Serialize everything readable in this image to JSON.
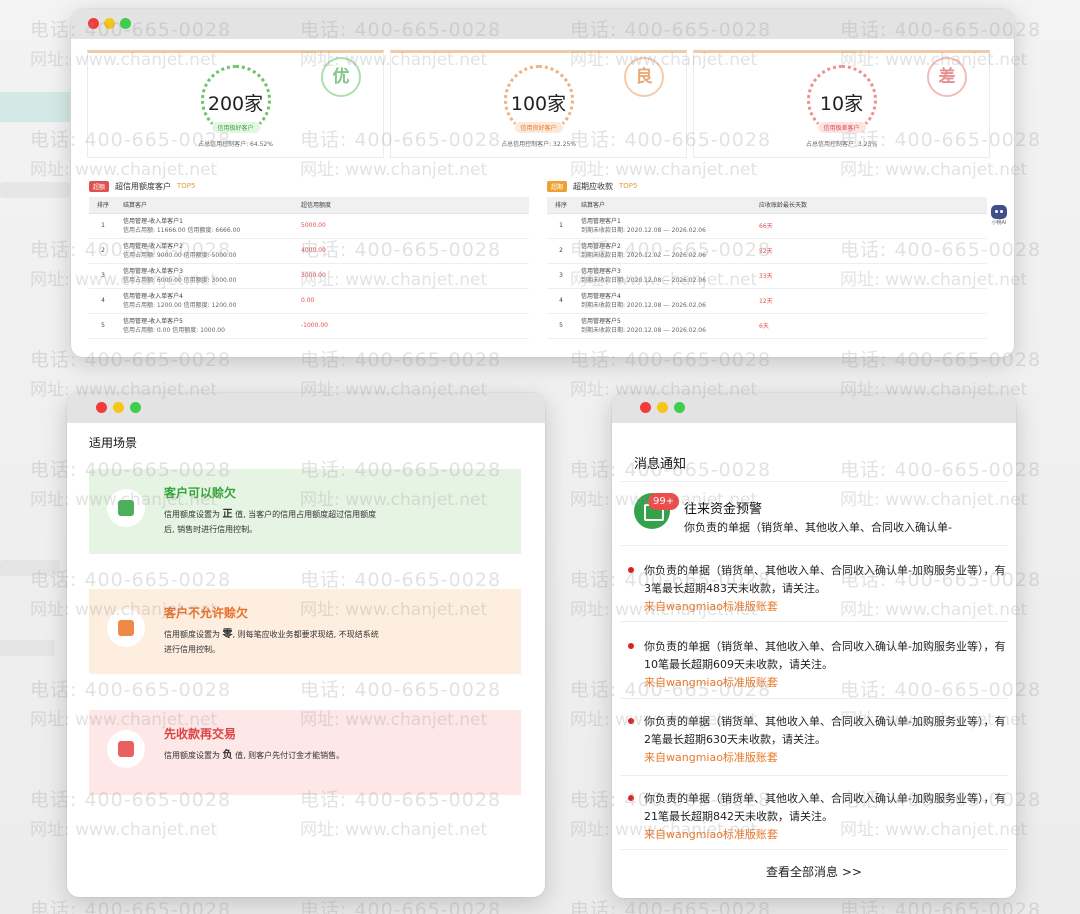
{
  "watermark": {
    "phone": "电话: 400-665-0028",
    "site": "网址: www.chanjet.net"
  },
  "credit_dashboard": {
    "scores": [
      {
        "count": "200家",
        "tag": "信用极好客户",
        "share": "占总信用控制客户: 64.52%",
        "stamp": "优"
      },
      {
        "count": "100家",
        "tag": "信用良好客户",
        "share": "占总信用控制客户: 32.25%",
        "stamp": "良"
      },
      {
        "count": "10家",
        "tag": "信用极差客户",
        "share": "占总信用控制客户: 3.23%",
        "stamp": "差"
      }
    ],
    "over_limit": {
      "badge": "超额",
      "title": "超信用额度客户",
      "top": "TOP5",
      "headers": [
        "排序",
        "结算客户",
        "超信用额度"
      ],
      "rows": [
        {
          "no": "1",
          "name": "信用管理-收入单客户1",
          "detail": "信用占用额: 11666.00  信用额度: 6666.00",
          "value": "5000.00"
        },
        {
          "no": "2",
          "name": "信用管理-收入单客户2",
          "detail": "信用占用额: 9000.00  信用额度: 5000.00",
          "value": "4000.00"
        },
        {
          "no": "3",
          "name": "信用管理-收入单客户3",
          "detail": "信用占用额: 6000.00  信用额度: 3000.00",
          "value": "3000.00"
        },
        {
          "no": "4",
          "name": "信用管理-收入单客户4",
          "detail": "信用占用额: 1200.00  信用额度: 1200.00",
          "value": "0.00"
        },
        {
          "no": "5",
          "name": "信用管理-收入单客户5",
          "detail": "信用占用额: 0.00  信用额度: 1000.00",
          "value": "-1000.00"
        }
      ]
    },
    "overdue": {
      "badge": "超期",
      "title": "超期应收款",
      "top": "TOP5",
      "headers": [
        "排序",
        "结算客户",
        "应收账龄最长天数"
      ],
      "rows": [
        {
          "no": "1",
          "name": "信用管理客户1",
          "detail": "到期未收款日期: 2020.12.08 --- 2026.02.06",
          "value": "66天"
        },
        {
          "no": "2",
          "name": "信用管理客户2",
          "detail": "到期未收款日期: 2020.12.02 --- 2026.02.06",
          "value": "52天"
        },
        {
          "no": "3",
          "name": "信用管理客户3",
          "detail": "到期未收款日期: 2020.12.08 --- 2026.02.06",
          "value": "33天"
        },
        {
          "no": "4",
          "name": "信用管理客户4",
          "detail": "到期未收款日期: 2020.12.08 --- 2026.02.06",
          "value": "12天"
        },
        {
          "no": "5",
          "name": "信用管理客户5",
          "detail": "到期未收款日期: 2020.12.08 --- 2026.02.06",
          "value": "6天"
        }
      ]
    },
    "assistant_label": "小畅AI"
  },
  "scenarios": {
    "title": "适用场景",
    "cards": [
      {
        "title": "客户可以赊欠",
        "desc_prefix": "信用额度设置为",
        "desc_key": "正",
        "desc_suffix": "值, 当客户的信用占用额度超过信用额度后, 销售时进行信用控制。"
      },
      {
        "title": "客户不允许赊欠",
        "desc_prefix": "信用额度设置为",
        "desc_key": "零",
        "desc_suffix": ", 则每笔应收业务都要求现结, 不现结系统进行信用控制。"
      },
      {
        "title": "先收款再交易",
        "desc_prefix": "信用额度设置为",
        "desc_key": "负",
        "desc_suffix": "值, 则客户先付订金才能销售。"
      }
    ]
  },
  "notifications": {
    "title": "消息通知",
    "alert": {
      "badge": "99+",
      "title": "往来资金预警",
      "desc": "你负责的单据（销货单、其他收入单、合同收入确认单-"
    },
    "items": [
      {
        "text": "你负责的单据（销货单、其他收入单、合同收入确认单-加购服务业等），有3笔最长超期483天未收款，请关注。",
        "source": "来自wangmiao标准版账套"
      },
      {
        "text": "你负责的单据（销货单、其他收入单、合同收入确认单-加购服务业等），有10笔最长超期609天未收款，请关注。",
        "source": "来自wangmiao标准版账套"
      },
      {
        "text": "你负责的单据（销货单、其他收入单、合同收入确认单-加购服务业等），有2笔最长超期630天未收款，请关注。",
        "source": "来自wangmiao标准版账套"
      },
      {
        "text": "你负责的单据（销货单、其他收入单、合同收入确认单-加购服务业等），有21笔最长超期842天未收款，请关注。",
        "source": "来自wangmiao标准版账套"
      }
    ],
    "view_all": "查看全部消息 >>"
  }
}
